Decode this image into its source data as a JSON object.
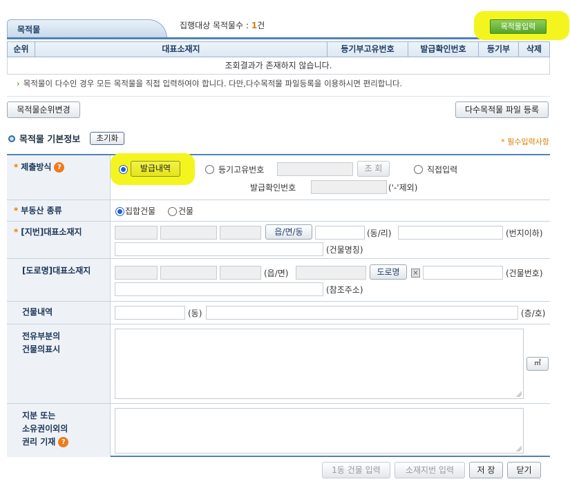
{
  "header": {
    "tab_label": "목적물",
    "count_label": "집행대상 목적물수 :",
    "count_value": "1",
    "count_unit": "건",
    "input_button": "목적물입력"
  },
  "table": {
    "columns": [
      "순위",
      "대표소재지",
      "등기부고유번호",
      "발급확인번호",
      "등기부",
      "삭제"
    ],
    "empty_message": "조회결과가 존재하지 않습니다."
  },
  "notice": "목적물이 다수인 경우 모든 목적물을 직접 입력하여야 합니다. 다만,다수목적물 파일등록을 이용하시면 편리합니다.",
  "buttons": {
    "change_order": "목적물순위변경",
    "multi_file": "다수목적물 파일 등록"
  },
  "section": {
    "title": "목적물 기본정보",
    "reset": "초기화",
    "required_note": "* 필수입력사항"
  },
  "form": {
    "submit_method": {
      "label": "제출방식",
      "opt_issue": "발급내역",
      "opt_regno": "등기고유번호",
      "lookup": "조 회",
      "opt_direct": "직접입력",
      "issue_confirm_label": "발급확인번호",
      "issue_confirm_hint": "('-'제외)"
    },
    "property_type": {
      "label": "부동산 종류",
      "opt_collective": "집합건물",
      "opt_building": "건물"
    },
    "lot_address": {
      "label": "[지번]대표소재지",
      "btn": "읍/면/동",
      "dong_ri": "(동/리)",
      "lot_no": "(번지이하)",
      "bldg_name": "(건물명칭)"
    },
    "road_address": {
      "label": "[도로명]대표소재지",
      "eup_myeon": "(읍/면)",
      "btn": "도로명",
      "bldg_no": "(건물번호)",
      "ref_addr": "(참조주소)"
    },
    "building_detail": {
      "label": "건물내역",
      "dong": "(동)",
      "floor_ho": "(층/호)"
    },
    "exclusive_part": {
      "label_line1": "전유부분의",
      "label_line2": "건물의표시",
      "unit_btn": "㎡"
    },
    "share": {
      "label_line1": "지분 또는",
      "label_line2": "소유권이외의",
      "label_line3": "권리 기재"
    }
  },
  "footer": {
    "btn_building": "1동 건물 입력",
    "btn_lot": "소재지번 입력",
    "btn_save": "저 장",
    "btn_close": "닫기"
  },
  "icons": {
    "help": "help-icon",
    "bullet": "circle-bullet-icon",
    "arrow": "arrow-right-icon"
  },
  "colors": {
    "highlight": "#f4f51e",
    "accent": "#4f81b5",
    "required": "#e67e00"
  }
}
